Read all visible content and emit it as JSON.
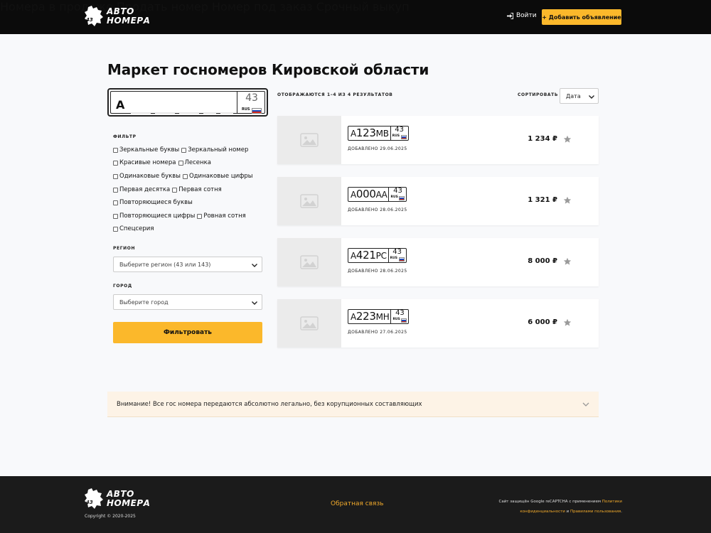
{
  "header": {
    "logo_line1": "АВТО",
    "logo_line2": "НОМЕРА",
    "logo_badge": "43",
    "nav": [
      "Номера в продаже",
      "Продать номер",
      "Номер под заказ",
      "Срочный выкуп"
    ],
    "login": "Войти",
    "add_button": "+ Добавить объявление"
  },
  "page_title": "Маркет госномеров Кировской области",
  "plate_builder": {
    "letter": "А",
    "region": "43",
    "country": "RUS"
  },
  "filter": {
    "label": "ФИЛЬТР",
    "rows": [
      [
        "Зеркальные буквы",
        "Зеркальный номер"
      ],
      [
        "Красивые номера",
        "Лесенка"
      ],
      [
        "Одинаковые буквы",
        "Одинаковые цифры"
      ],
      [
        "Первая десятка",
        "Первая сотня"
      ],
      [
        "Повторяющиеся буквы"
      ],
      [
        "Повторяющиеся цифры",
        "Ровная сотня"
      ],
      [
        "Спецсерия"
      ]
    ],
    "region_label": "РЕГИОН",
    "region_placeholder": "Выберите регион (43 или 143)",
    "city_label": "ГОРОД",
    "city_placeholder": "Выберите город",
    "button": "Фильтровать"
  },
  "results": {
    "count_text": "ОТОБРАЖАЮТСЯ 1–4 ИЗ 4 РЕЗУЛЬТАТОВ",
    "sort_label": "СОРТИРОВАТЬ ПО",
    "sort_value": "Дата",
    "items": [
      {
        "l1": "А",
        "num": "123",
        "l2": "МВ",
        "region": "43",
        "rus": "RUS",
        "added": "ДОБАВЛЕНО 29.06.2025",
        "price": "1 234 ₽"
      },
      {
        "l1": "А",
        "num": "000",
        "l2": "АА",
        "region": "43",
        "rus": "RUS",
        "added": "ДОБАВЛЕНО 28.06.2025",
        "price": "1 321 ₽"
      },
      {
        "l1": "А",
        "num": "421",
        "l2": "РС",
        "region": "43",
        "rus": "RUS",
        "added": "ДОБАВЛЕНО 28.06.2025",
        "price": "8 000 ₽"
      },
      {
        "l1": "А",
        "num": "223",
        "l2": "МН",
        "region": "43",
        "rus": "RUS",
        "added": "ДОБАВЛЕНО 27.06.2025",
        "price": "6 000 ₽"
      }
    ]
  },
  "notice": "Внимание! Все гос номера передаются абсолютно легально, без корупционных составляющих",
  "footer": {
    "logo_line1": "АВТО",
    "logo_line2": "НОМЕРА",
    "logo_badge": "43",
    "copyright": "Copyright © 2020-2025",
    "feedback": "Обратная связь",
    "recaptcha_text": "Сайт защищён Google reCAPTCHA с применением",
    "recaptcha_link1": "Политики конфиденциальности",
    "recaptcha_and": "и",
    "recaptcha_link2": "Правилами пользования",
    "recaptcha_end": "."
  },
  "colors": {
    "accent": "#fbb82b",
    "header_bg": "#0b0b0b",
    "footer_bg": "#1b1b1b",
    "link": "#f0a92b"
  }
}
